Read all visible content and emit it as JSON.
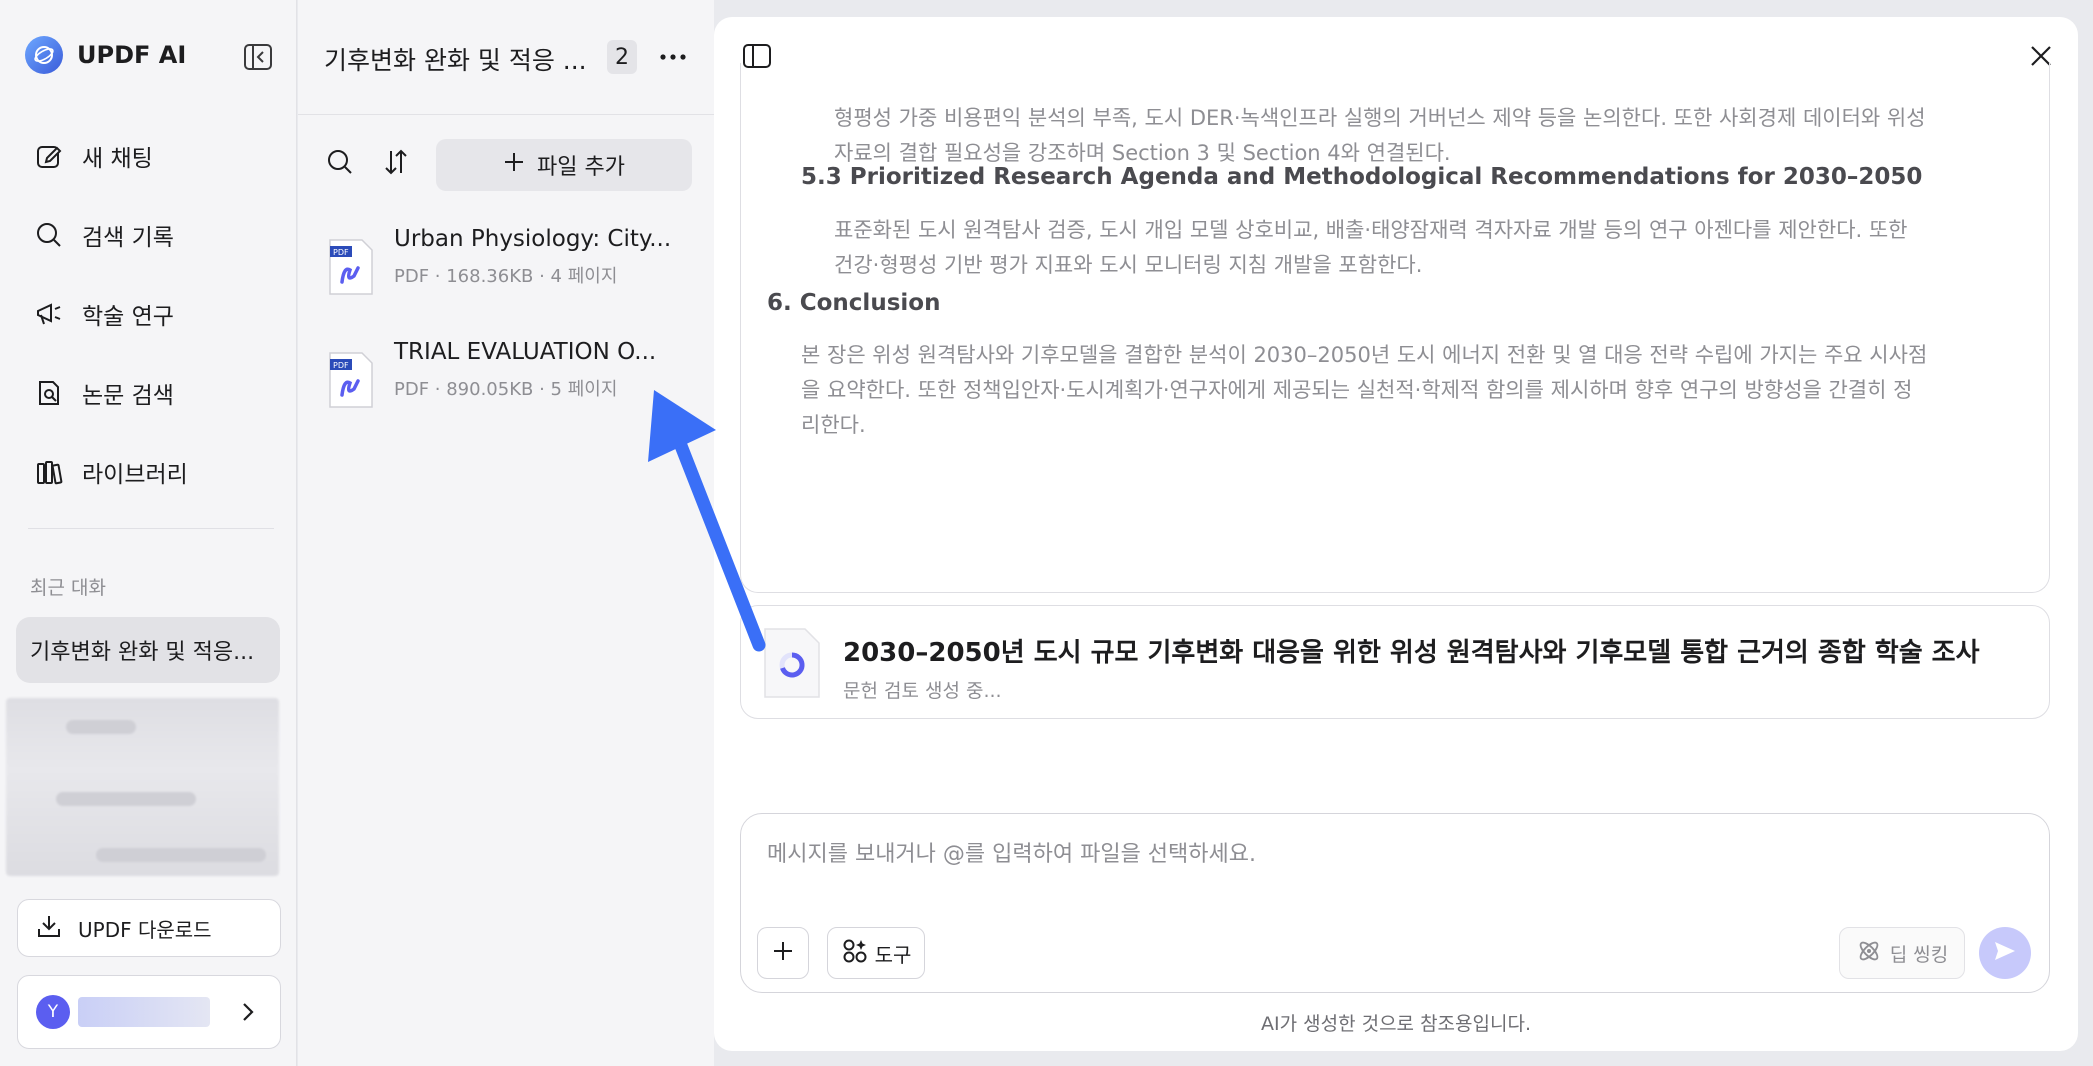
{
  "app": {
    "name": "UPDF AI"
  },
  "sidebar": {
    "items": [
      {
        "label": "새 채팅",
        "icon": "edit-icon"
      },
      {
        "label": "검색 기록",
        "icon": "search-icon"
      },
      {
        "label": "학술 연구",
        "icon": "megaphone-icon"
      },
      {
        "label": "논문 검색",
        "icon": "doc-search-icon"
      },
      {
        "label": "라이브러리",
        "icon": "library-icon"
      }
    ],
    "recent_label": "최근 대화",
    "recent_items": [
      {
        "label": "기후변화 완화 및 적응..."
      }
    ],
    "download_label": "UPDF 다운로드",
    "account": {
      "initial": "Y"
    }
  },
  "file_panel": {
    "title": "기후변화 완화 및 적응 ...",
    "count": "2",
    "add_file_label": "파일 추가",
    "files": [
      {
        "name": "Urban Physiology: City...",
        "meta": "PDF · 168.36KB · 4 페이지"
      },
      {
        "name": "TRIAL EVALUATION O...",
        "meta": "PDF · 890.05KB · 5 페이지"
      }
    ]
  },
  "chat": {
    "content": {
      "para1_line1": "형평성 가중 비용편익 분석의 부족, 도시 DER·녹색인프라 실행의 거버넌스 제약 등을 논의한다. 또한 사회경제 데이터와 위성",
      "para1_line2": "자료의 결합 필요성을 강조하며 Section 3 및 Section 4와 연결된다.",
      "heading_5_3": "5.3 Prioritized Research Agenda and Methodological Recommendations for 2030–2050",
      "para2_line1": "표준화된 도시 원격탐사 검증, 도시 개입 모델 상호비교, 배출·태양잠재력 격자자료 개발 등의 연구 아젠다를 제안한다. 또한",
      "para2_line2": "건강·형평성 기반 평가 지표와 도시 모니터링 지침 개발을 포함한다.",
      "heading_6": "6. Conclusion",
      "para3_line1": "본 장은 위성 원격탐사와 기후모델을 결합한 분석이 2030–2050년 도시 에너지 전환 및 열 대응 전략 수립에 가지는 주요 시사점",
      "para3_line2": "을 요약한다. 또한 정책입안자·도시계획가·연구자에게 제공되는 실천적·학제적 함의를 제시하며 향후 연구의 방향성을 간결히 정",
      "para3_line3": "리한다."
    },
    "report": {
      "title": "2030–2050년 도시 규모 기후변화 대응을 위한 위성 원격탐사와 기후모델 통합 근거의 종합 학술 조사",
      "status": "문헌 검토 생성 중..."
    },
    "composer": {
      "placeholder": "메시지를 보내거나 @를 입력하여 파일을 선택하세요.",
      "tools_label": "도구",
      "deep_label": "딥 씽킹"
    },
    "disclaimer": "AI가 생성한 것으로 참조용입니다."
  },
  "colors": {
    "accent": "#3a6ff7",
    "send_disabled": "#c7c9fb",
    "arrow": "#3a6ff7"
  }
}
